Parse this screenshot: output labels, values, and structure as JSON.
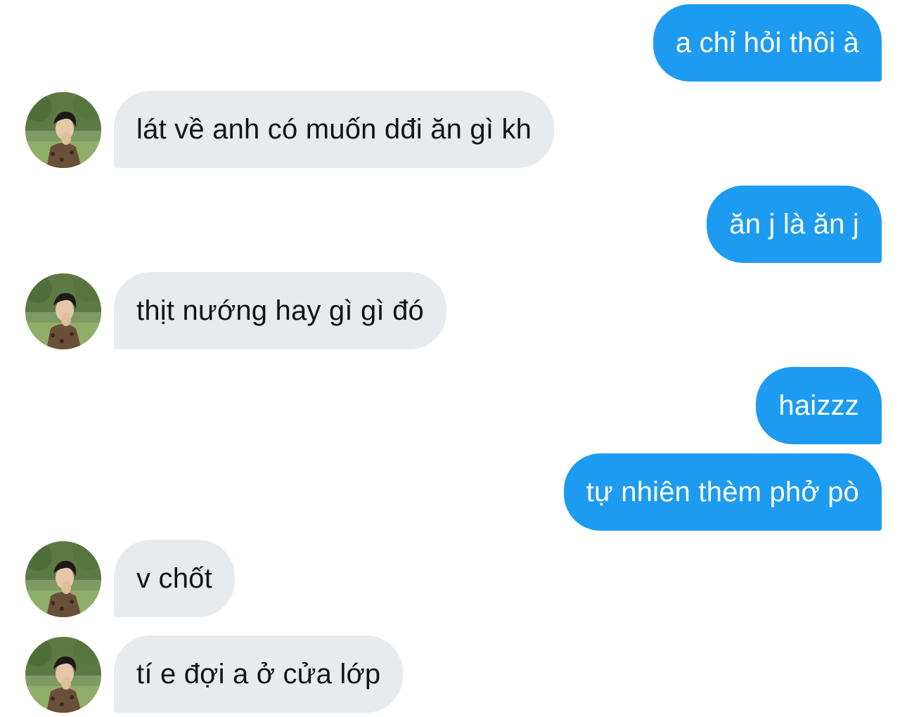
{
  "conversation": {
    "messages": [
      {
        "direction": "outgoing",
        "text": "a chỉ hỏi thôi à"
      },
      {
        "direction": "incoming",
        "text": "lát về anh có muốn dđi ăn gì kh"
      },
      {
        "direction": "outgoing",
        "text": "ăn j là ăn j"
      },
      {
        "direction": "incoming",
        "text": "thịt nướng hay gì gì đó"
      },
      {
        "direction": "outgoing",
        "text": "haizzz"
      },
      {
        "direction": "outgoing",
        "text": "tự nhiên thèm phở pò"
      },
      {
        "direction": "incoming",
        "text": "v chốt"
      },
      {
        "direction": "incoming",
        "text": "tí e đợi a ở cửa lớp"
      }
    ]
  },
  "colors": {
    "outgoing_bubble": "#1d9bf0",
    "outgoing_text": "#ffffff",
    "incoming_bubble": "#e7ebee",
    "incoming_text": "#0f1419",
    "background": "#ffffff"
  },
  "icons": {
    "avatar": "profile-photo-avatar"
  }
}
